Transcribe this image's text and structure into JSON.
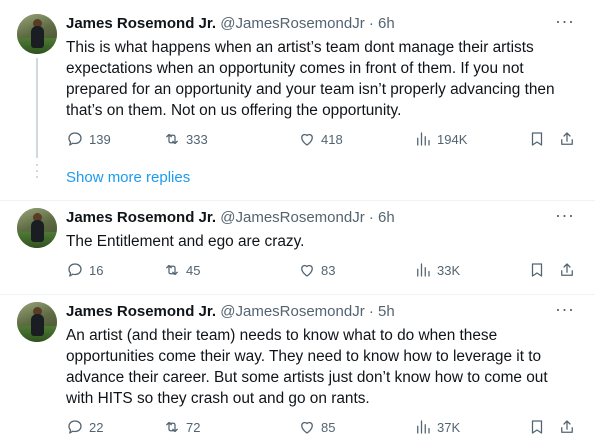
{
  "tweets": [
    {
      "name": "James Rosemond Jr.",
      "handle": "@JamesRosemondJr",
      "time": "· 6h",
      "text": "This is what happens when an artist’s team dont manage their artists expectations when an opportunity comes in front of them. If you not prepared for an opportunity and your team isn’t properly advancing then that’s on them. Not on us offering the opportunity.",
      "replies": "139",
      "retweets": "333",
      "likes": "418",
      "views": "194K"
    },
    {
      "name": "James Rosemond Jr.",
      "handle": "@JamesRosemondJr",
      "time": "· 6h",
      "text": "The Entitlement and ego are crazy.",
      "replies": "16",
      "retweets": "45",
      "likes": "83",
      "views": "33K"
    },
    {
      "name": "James Rosemond Jr.",
      "handle": "@JamesRosemondJr",
      "time": "· 5h",
      "text": "An artist (and their team) needs to know what to do when these opportunities come their way. They need to know how to leverage it to advance their career. But some artists just don’t know how to come out with HITS so they crash out and go on rants.",
      "replies": "22",
      "retweets": "72",
      "likes": "85",
      "views": "37K"
    }
  ],
  "show_more_replies": "Show more replies",
  "more_icon": "···",
  "colors": {
    "link": "#1d9bf0",
    "muted": "#536471",
    "text": "#0f1419"
  }
}
